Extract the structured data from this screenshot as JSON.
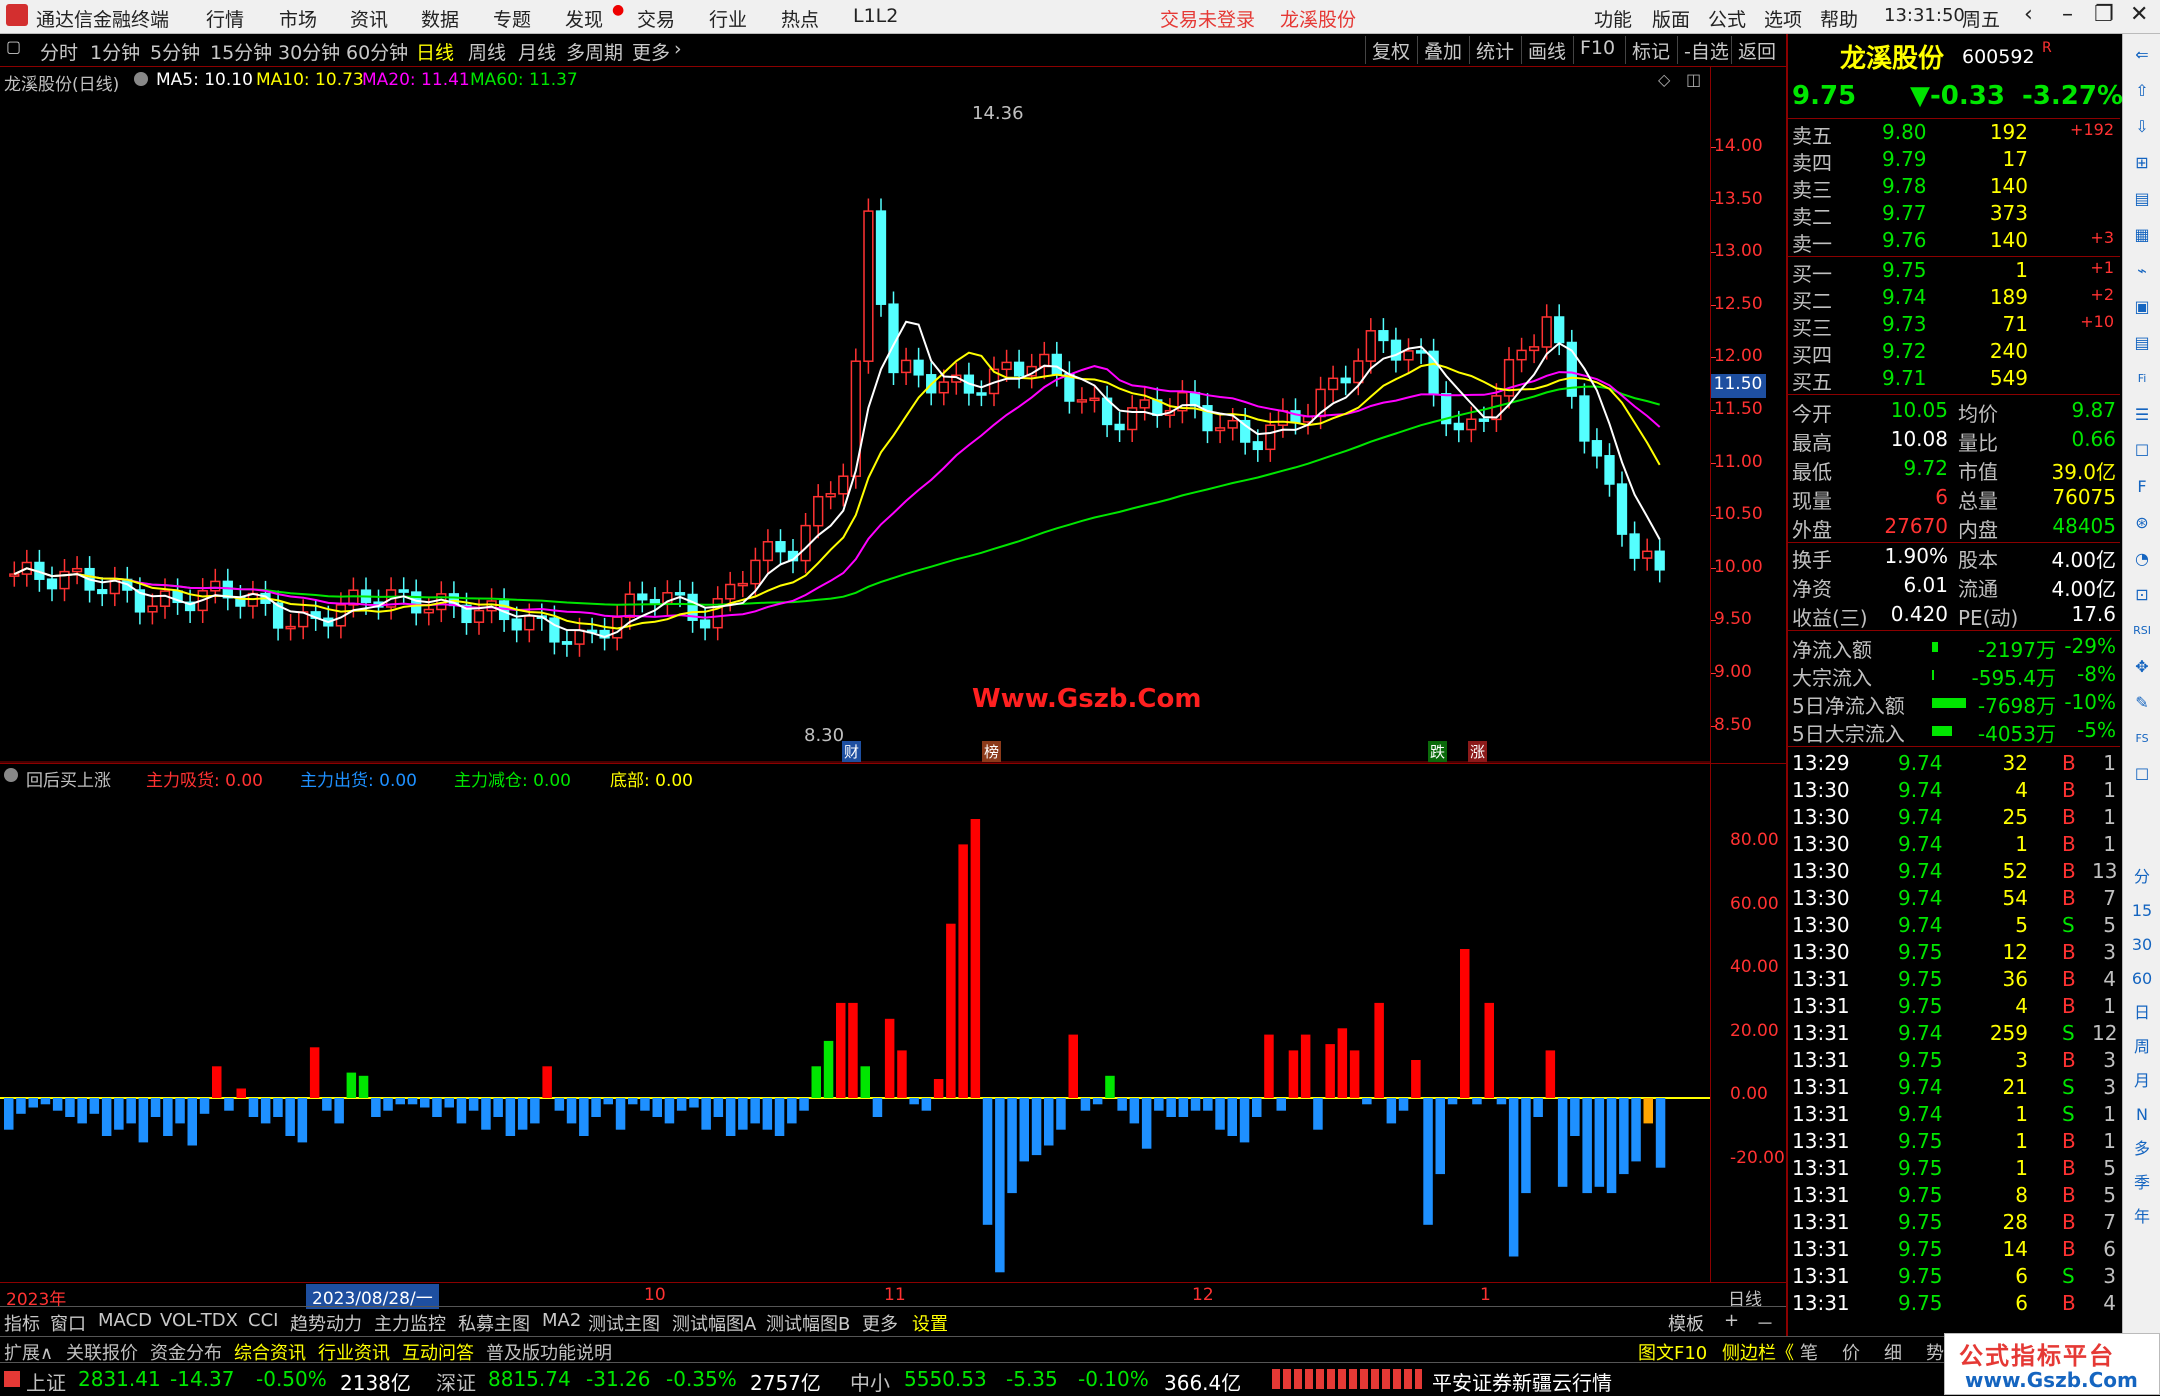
{
  "titlebar": {
    "app_name": "通达信金融终端",
    "menu": [
      "行情",
      "市场",
      "资讯",
      "数据",
      "专题",
      "发现",
      "交易",
      "行业",
      "热点",
      "L1L2"
    ],
    "login_status": "交易未登录",
    "stock": "龙溪股份",
    "right_menu": [
      "功能",
      "版面",
      "公式",
      "选项",
      "帮助"
    ],
    "time": "13:31:50",
    "weekday": "周五"
  },
  "periods": [
    "分时",
    "1分钟",
    "5分钟",
    "15分钟",
    "30分钟",
    "60分钟",
    "日线",
    "周线",
    "月线",
    "多周期",
    "更多"
  ],
  "selected_period": "日线",
  "tools": [
    "复权",
    "叠加",
    "统计",
    "画线",
    "F10",
    "标记",
    "-自选",
    "返回"
  ],
  "main_chart": {
    "title": "龙溪股份(日线)",
    "ma5": "MA5: 10.10",
    "ma10": "MA10: 10.73",
    "ma20": "MA20: 11.41",
    "ma60": "MA60: 11.37",
    "high_label": "14.36",
    "low_label": "8.30",
    "watermark": "Www.Gszb.Com",
    "current_price_tag": "11.50",
    "markers": [
      "财",
      "榜",
      "跌",
      "涨"
    ]
  },
  "price_axis": [
    "14.00",
    "13.50",
    "13.00",
    "12.50",
    "12.00",
    "11.50",
    "11.00",
    "10.50",
    "10.00",
    "9.50",
    "9.00",
    "8.50"
  ],
  "indicator": {
    "title": "回后买上涨",
    "s1": "主力吸货: 0.00",
    "s2": "主力出货: 0.00",
    "s3": "主力减仓: 0.00",
    "s4": "底部: 0.00",
    "axis": [
      "80.00",
      "60.00",
      "40.00",
      "20.00",
      "0.00",
      "-20.00"
    ]
  },
  "chart_data": {
    "type": "bar",
    "title": "回后买上涨",
    "ylim": [
      -60,
      100
    ],
    "series": [
      {
        "name": "主力吸货",
        "color": "#ff0000"
      },
      {
        "name": "主力出货",
        "color": "#1e90ff"
      },
      {
        "name": "主力减仓",
        "color": "#00e600"
      },
      {
        "name": "底部",
        "color": "#ffff00"
      }
    ],
    "values": [
      -10,
      -5,
      -3,
      -2,
      -4,
      -6,
      -8,
      -5,
      -12,
      -10,
      -8,
      -14,
      -6,
      -12,
      -8,
      -15,
      -5,
      10,
      -4,
      3,
      -6,
      -8,
      -6,
      -12,
      -14,
      16,
      -4,
      -8,
      8,
      7,
      -6,
      -4,
      -2,
      -2,
      -3,
      -6,
      -3,
      -8,
      -4,
      -10,
      -6,
      -12,
      -10,
      -8,
      10,
      -4,
      -8,
      -12,
      -6,
      -2,
      -10,
      -2,
      -4,
      -6,
      -8,
      -4,
      -3,
      -10,
      -6,
      -12,
      -10,
      -8,
      -10,
      -12,
      -8,
      -4,
      10,
      18,
      30,
      30,
      10,
      -6,
      25,
      15,
      -2,
      -4,
      6,
      55,
      80,
      88,
      -40,
      -55,
      -30,
      -20,
      -18,
      -15,
      -10,
      20,
      -4,
      -2,
      7,
      -4,
      -8,
      -16,
      -4,
      -6,
      -6,
      -4,
      -4,
      -10,
      -12,
      -14,
      -6,
      20,
      -4,
      15,
      20,
      -10,
      17,
      22,
      15,
      -2,
      30,
      -8,
      -4,
      12,
      -40,
      -24,
      -2,
      47,
      -2,
      30,
      -2,
      -50,
      -30,
      -6,
      15,
      -28,
      -12,
      -30,
      -28,
      -30,
      -24,
      -20,
      -8,
      -22
    ],
    "xlabels": [
      "2023年",
      "2023/08/28/一",
      "10",
      "11",
      "12",
      "1",
      "日线"
    ]
  },
  "xaxis": {
    "year": "2023年",
    "date": "2023/08/28/一",
    "m10": "10",
    "m11": "11",
    "m12": "12",
    "m1": "1",
    "period": "日线"
  },
  "tabs": [
    "指标",
    "窗口",
    "MACD",
    "VOL-TDX",
    "CCI",
    "趋势动力",
    "主力监控",
    "私募主图",
    "MA2",
    "测试主图",
    "测试幅图A",
    "测试幅图B",
    "更多",
    "设置"
  ],
  "tabs_right": [
    "模板",
    "+",
    "－"
  ],
  "ext": [
    "扩展∧",
    "关联报价",
    "资金分布",
    "综合资讯",
    "行业资讯",
    "互动问答",
    "普及版功能说明"
  ],
  "ext_right": [
    "图文F10",
    "侧边栏《",
    "笔",
    "价",
    "细",
    "势"
  ],
  "status": {
    "sh_label": "上证",
    "sh": "2831.41",
    "sh_chg": "-14.37",
    "sh_pct": "-0.50%",
    "sh_amt": "2138亿",
    "sz_label": "深证",
    "sz": "8815.74",
    "sz_chg": "-31.26",
    "sz_pct": "-0.35%",
    "sz_amt": "2757亿",
    "zx_label": "中小",
    "zx": "5550.53",
    "zx_chg": "-5.35",
    "zx_pct": "-0.10%",
    "zx_amt": "366.4亿",
    "broker": "平安证券新疆云行情",
    "brand": "公式指标平台",
    "brand_url": "www.Gszb.Com"
  },
  "quote": {
    "name": "龙溪股份",
    "code": "600592",
    "flag": "R",
    "price": "9.75",
    "chg": "▼-0.33",
    "pct": "-3.27%"
  },
  "asks": [
    {
      "label": "卖五",
      "price": "9.80",
      "vol": "192",
      "d": "+192"
    },
    {
      "label": "卖四",
      "price": "9.79",
      "vol": "17",
      "d": ""
    },
    {
      "label": "卖三",
      "price": "9.78",
      "vol": "140",
      "d": ""
    },
    {
      "label": "卖二",
      "price": "9.77",
      "vol": "373",
      "d": ""
    },
    {
      "label": "卖一",
      "price": "9.76",
      "vol": "140",
      "d": "+3"
    }
  ],
  "bids": [
    {
      "label": "买一",
      "price": "9.75",
      "vol": "1",
      "d": "+1"
    },
    {
      "label": "买二",
      "price": "9.74",
      "vol": "189",
      "d": "+2"
    },
    {
      "label": "买三",
      "price": "9.73",
      "vol": "71",
      "d": "+10"
    },
    {
      "label": "买四",
      "price": "9.72",
      "vol": "240",
      "d": ""
    },
    {
      "label": "买五",
      "price": "9.71",
      "vol": "549",
      "d": ""
    }
  ],
  "stats": [
    [
      "今开",
      "10.05",
      "均价",
      "9.87"
    ],
    [
      "最高",
      "10.08",
      "量比",
      "0.66"
    ],
    [
      "最低",
      "9.72",
      "市值",
      "39.0亿"
    ],
    [
      "现量",
      "6",
      "总量",
      "76075"
    ],
    [
      "外盘",
      "27670",
      "内盘",
      "48405"
    ]
  ],
  "stats2": [
    [
      "换手",
      "1.90%",
      "股本",
      "4.00亿"
    ],
    [
      "净资",
      "6.01",
      "流通",
      "4.00亿"
    ],
    [
      "收益(三)",
      "0.420",
      "PE(动)",
      "17.6"
    ]
  ],
  "flows": [
    [
      "净流入额",
      "-2197万",
      "-29%"
    ],
    [
      "大宗流入",
      "-595.4万",
      "-8%"
    ],
    [
      "5日净流入额",
      "-7698万",
      "-10%"
    ],
    [
      "5日大宗流入",
      "-4053万",
      "-5%"
    ]
  ],
  "ticks": [
    [
      "13:29",
      "9.74",
      "32",
      "B",
      "1"
    ],
    [
      "13:30",
      "9.74",
      "4",
      "B",
      "1"
    ],
    [
      "13:30",
      "9.74",
      "25",
      "B",
      "1"
    ],
    [
      "13:30",
      "9.74",
      "1",
      "B",
      "1"
    ],
    [
      "13:30",
      "9.74",
      "52",
      "B",
      "13"
    ],
    [
      "13:30",
      "9.74",
      "54",
      "B",
      "7"
    ],
    [
      "13:30",
      "9.74",
      "5",
      "S",
      "5"
    ],
    [
      "13:30",
      "9.75",
      "12",
      "B",
      "3"
    ],
    [
      "13:31",
      "9.75",
      "36",
      "B",
      "4"
    ],
    [
      "13:31",
      "9.75",
      "4",
      "B",
      "1"
    ],
    [
      "13:31",
      "9.74",
      "259",
      "S",
      "12"
    ],
    [
      "13:31",
      "9.75",
      "3",
      "B",
      "3"
    ],
    [
      "13:31",
      "9.74",
      "21",
      "S",
      "3"
    ],
    [
      "13:31",
      "9.74",
      "1",
      "S",
      "1"
    ],
    [
      "13:31",
      "9.75",
      "1",
      "B",
      "1"
    ],
    [
      "13:31",
      "9.75",
      "1",
      "B",
      "5"
    ],
    [
      "13:31",
      "9.75",
      "8",
      "B",
      "5"
    ],
    [
      "13:31",
      "9.75",
      "28",
      "B",
      "7"
    ],
    [
      "13:31",
      "9.75",
      "14",
      "B",
      "6"
    ],
    [
      "13:31",
      "9.75",
      "6",
      "S",
      "3"
    ],
    [
      "13:31",
      "9.75",
      "6",
      "B",
      "4"
    ]
  ],
  "side_icons": [
    "分",
    "15",
    "30",
    "60",
    "日",
    "周",
    "月",
    "N",
    "多",
    "季",
    "年"
  ]
}
